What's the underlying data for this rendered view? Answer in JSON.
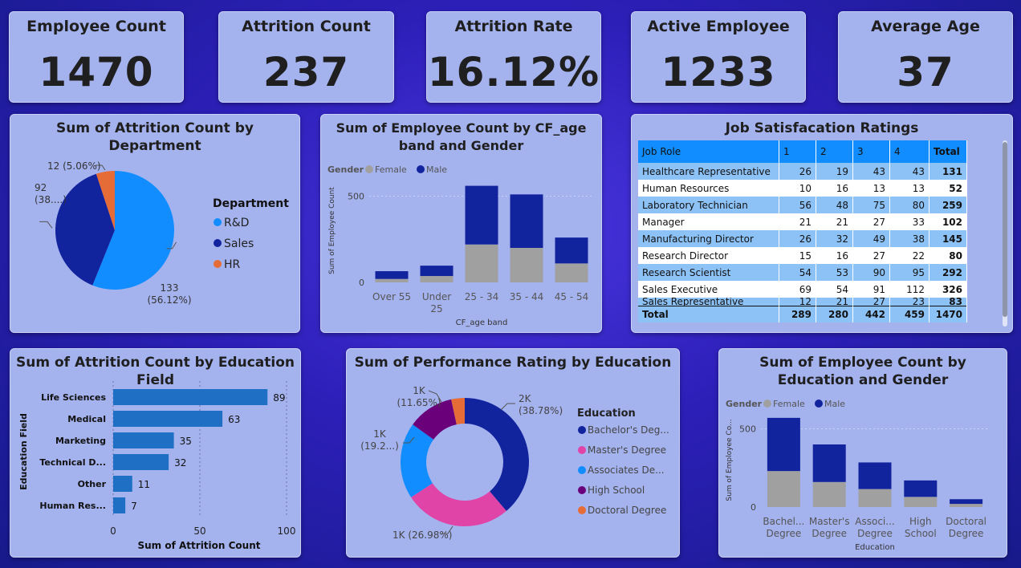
{
  "kpis": {
    "employee_count": {
      "label": "Employee Count",
      "value": "1470"
    },
    "attrition_count": {
      "label": "Attrition Count",
      "value": "237"
    },
    "attrition_rate": {
      "label": "Attrition Rate",
      "value": "16.12%"
    },
    "active_employee": {
      "label": "Active Employee",
      "value": "1233"
    },
    "average_age": {
      "label": "Average Age",
      "value": "37"
    }
  },
  "colors": {
    "rnd": "#118dff",
    "sales": "#12239e",
    "hr": "#e66c37",
    "female": "#a0a0a0",
    "male": "#12239e",
    "bar_blue": "#1f6fc4",
    "masters": "#e044a7",
    "high_school": "#6b007b"
  },
  "table": {
    "title": "Job Satisfacation Ratings",
    "headers": [
      "Job Role",
      "1",
      "2",
      "3",
      "4",
      "Total"
    ],
    "rows": [
      [
        "Healthcare Representative",
        "26",
        "19",
        "43",
        "43",
        "131"
      ],
      [
        "Human Resources",
        "10",
        "16",
        "13",
        "13",
        "52"
      ],
      [
        "Laboratory Technician",
        "56",
        "48",
        "75",
        "80",
        "259"
      ],
      [
        "Manager",
        "21",
        "21",
        "27",
        "33",
        "102"
      ],
      [
        "Manufacturing Director",
        "26",
        "32",
        "49",
        "38",
        "145"
      ],
      [
        "Research Director",
        "15",
        "16",
        "27",
        "22",
        "80"
      ],
      [
        "Research Scientist",
        "54",
        "53",
        "90",
        "95",
        "292"
      ],
      [
        "Sales Executive",
        "69",
        "54",
        "91",
        "112",
        "326"
      ],
      [
        "Sales Representative",
        "12",
        "21",
        "27",
        "23",
        "83"
      ]
    ],
    "total": [
      "Total",
      "289",
      "280",
      "442",
      "459",
      "1470"
    ]
  },
  "chart_data": [
    {
      "type": "pie",
      "title": "Sum of Attrition Count by Department",
      "legend_title": "Department",
      "legend_position": "right",
      "categories": [
        "R&D",
        "Sales",
        "HR"
      ],
      "values": [
        133,
        92,
        12
      ],
      "data_labels": [
        "133\n(56.12%)",
        "92\n(38....)",
        "12 (5.06%)"
      ]
    },
    {
      "type": "bar",
      "stacked": true,
      "title": "Sum of Employee Count by CF_age band and Gender",
      "legend_title": "Gender",
      "legend_position": "top-left",
      "xlabel": "CF_age band",
      "ylabel": "Sum of Employee Count",
      "categories": [
        "Over 55",
        "Under 25",
        "25 - 34",
        "35 - 44",
        "45 - 54"
      ],
      "series": [
        {
          "name": "Female",
          "values": [
            20,
            37,
            220,
            200,
            110
          ]
        },
        {
          "name": "Male",
          "values": [
            45,
            60,
            340,
            310,
            150
          ]
        }
      ],
      "yticks": [
        "0",
        "500"
      ],
      "ylim": [
        0,
        600
      ]
    },
    {
      "type": "bar",
      "orientation": "horizontal",
      "title": "Sum of Attrition Count by Education Field",
      "xlabel": "Sum of Attrition Count",
      "ylabel": "Education Field",
      "categories": [
        "Life Sciences",
        "Medical",
        "Marketing",
        "Technical D...",
        "Other",
        "Human Res..."
      ],
      "values": [
        89,
        63,
        35,
        32,
        11,
        7
      ],
      "xticks": [
        "0",
        "50",
        "100"
      ],
      "xlim": [
        0,
        100
      ]
    },
    {
      "type": "pie",
      "donut": true,
      "title": "Sum of Performance Rating by Education",
      "legend_title": "Education",
      "legend_position": "right",
      "categories": [
        "Bachelor's Deg...",
        "Master's Degree",
        "Associates De...",
        "High School",
        "Doctoral Degree"
      ],
      "values": [
        38.78,
        26.98,
        19.2,
        11.65,
        3.39
      ],
      "data_labels": [
        "2K\n(38.78%)",
        "1K (26.98%)",
        "1K\n(19.2...)",
        "1K\n(11.65%)",
        ""
      ]
    },
    {
      "type": "bar",
      "stacked": true,
      "title": "Sum of Employee Count by Education and Gender",
      "legend_title": "Gender",
      "legend_position": "top-left",
      "xlabel": "Education",
      "ylabel": "Sum of Employee Co...",
      "categories": [
        "Bachel... Degree",
        "Master's Degree",
        "Associ... Degree",
        "High School",
        "Doctoral Degree"
      ],
      "series": [
        {
          "name": "Female",
          "values": [
            230,
            160,
            115,
            65,
            20
          ]
        },
        {
          "name": "Male",
          "values": [
            340,
            240,
            170,
            105,
            30
          ]
        }
      ],
      "yticks": [
        "0",
        "500"
      ],
      "ylim": [
        0,
        600
      ]
    }
  ]
}
